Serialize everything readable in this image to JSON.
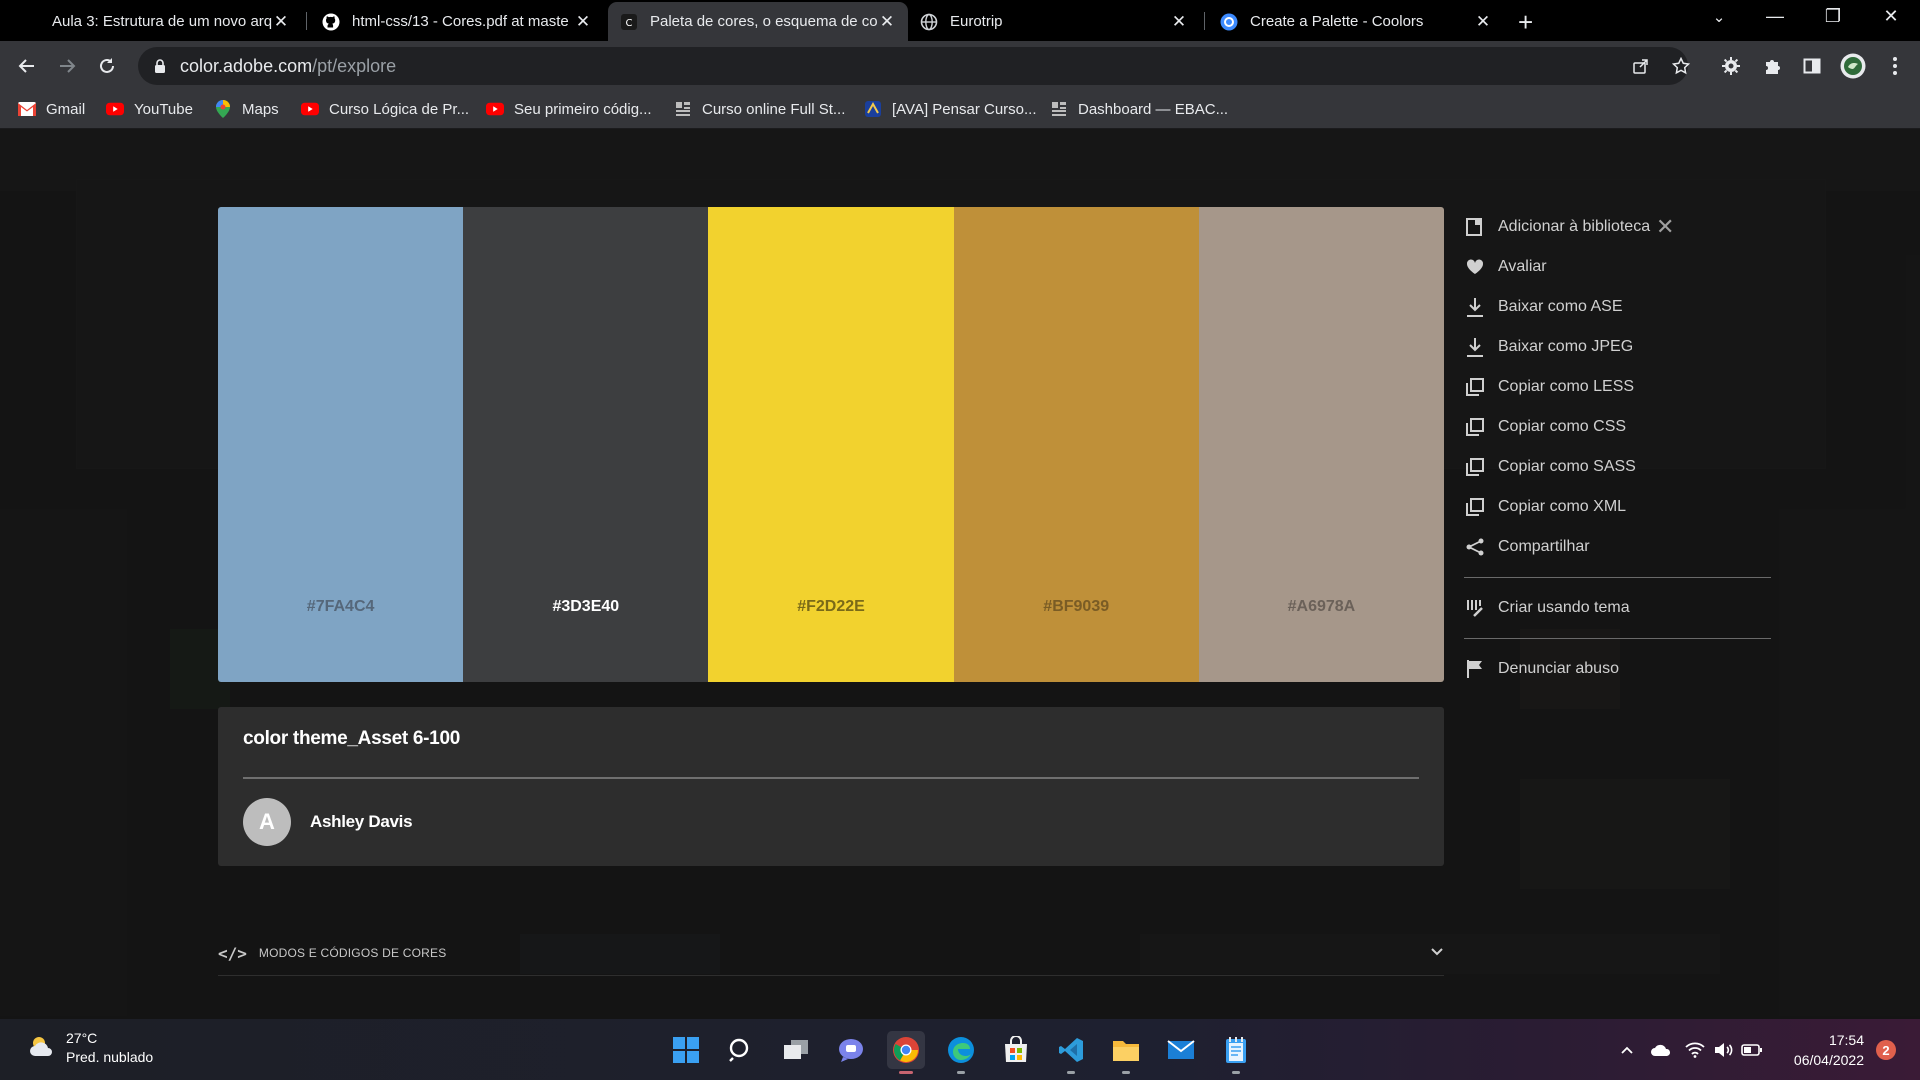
{
  "browser": {
    "tabs": [
      {
        "title": "Aula 3: Estrutura de um novo arq",
        "icon": "page-icon",
        "active": false
      },
      {
        "title": "html-css/13 - Cores.pdf at maste",
        "icon": "github-icon",
        "active": false
      },
      {
        "title": "Paleta de cores, o esquema de co",
        "icon": "adobe-color-icon",
        "active": true
      },
      {
        "title": "Eurotrip",
        "icon": "globe-icon",
        "active": false
      },
      {
        "title": "Create a Palette - Coolors",
        "icon": "coolors-icon",
        "active": false
      }
    ],
    "url_host": "color.adobe.com",
    "url_path": "/pt/explore",
    "bookmarks": [
      {
        "label": "Gmail",
        "icon": "gmail-icon"
      },
      {
        "label": "YouTube",
        "icon": "youtube-icon"
      },
      {
        "label": "Maps",
        "icon": "maps-icon"
      },
      {
        "label": "Curso Lógica de Pr...",
        "icon": "youtube-icon"
      },
      {
        "label": "Seu primeiro códig...",
        "icon": "youtube-icon"
      },
      {
        "label": "Curso online Full St...",
        "icon": "ebac-icon"
      },
      {
        "label": "[AVA] Pensar Curso...",
        "icon": "ava-icon"
      },
      {
        "label": "Dashboard — EBAC...",
        "icon": "ebac-icon"
      }
    ]
  },
  "palette": {
    "swatches": [
      {
        "hex": "#7FA4C4",
        "color": "#7FA4C4",
        "text_color": "#55677a"
      },
      {
        "hex": "#3D3E40",
        "color": "#3D3E40",
        "text_color": "#ffffff"
      },
      {
        "hex": "#F2D22E",
        "color": "#F2D22E",
        "text_color": "#7a6a18"
      },
      {
        "hex": "#BF9039",
        "color": "#BF9039",
        "text_color": "#7a5c25"
      },
      {
        "hex": "#A6978A",
        "color": "#A6978A",
        "text_color": "#6b6159"
      }
    ],
    "title": "color theme_Asset 6-100",
    "author_initial": "A",
    "author_name": "Ashley Davis",
    "modes_label": "MODOS E CÓDIGOS DE CORES"
  },
  "menu": {
    "items": [
      {
        "label": "Adicionar à biblioteca",
        "icon": "library-icon"
      },
      {
        "label": "Avaliar",
        "icon": "heart-icon"
      },
      {
        "label": "Baixar como ASE",
        "icon": "download-icon"
      },
      {
        "label": "Baixar como JPEG",
        "icon": "download-icon"
      },
      {
        "label": "Copiar como LESS",
        "icon": "copy-icon"
      },
      {
        "label": "Copiar como CSS",
        "icon": "copy-icon"
      },
      {
        "label": "Copiar como SASS",
        "icon": "copy-icon"
      },
      {
        "label": "Copiar como XML",
        "icon": "copy-icon"
      },
      {
        "label": "Compartilhar",
        "icon": "share-icon"
      },
      {
        "label": "Criar usando tema",
        "icon": "create-theme-icon"
      },
      {
        "label": "Denunciar abuso",
        "icon": "flag-icon"
      }
    ]
  },
  "taskbar": {
    "temperature": "27°C",
    "weather_desc": "Pred. nublado",
    "time": "17:54",
    "date": "06/04/2022",
    "notifications": "2"
  },
  "colors": {
    "accent_indicator": "#c76470",
    "notif_badge": "#e0604c"
  }
}
